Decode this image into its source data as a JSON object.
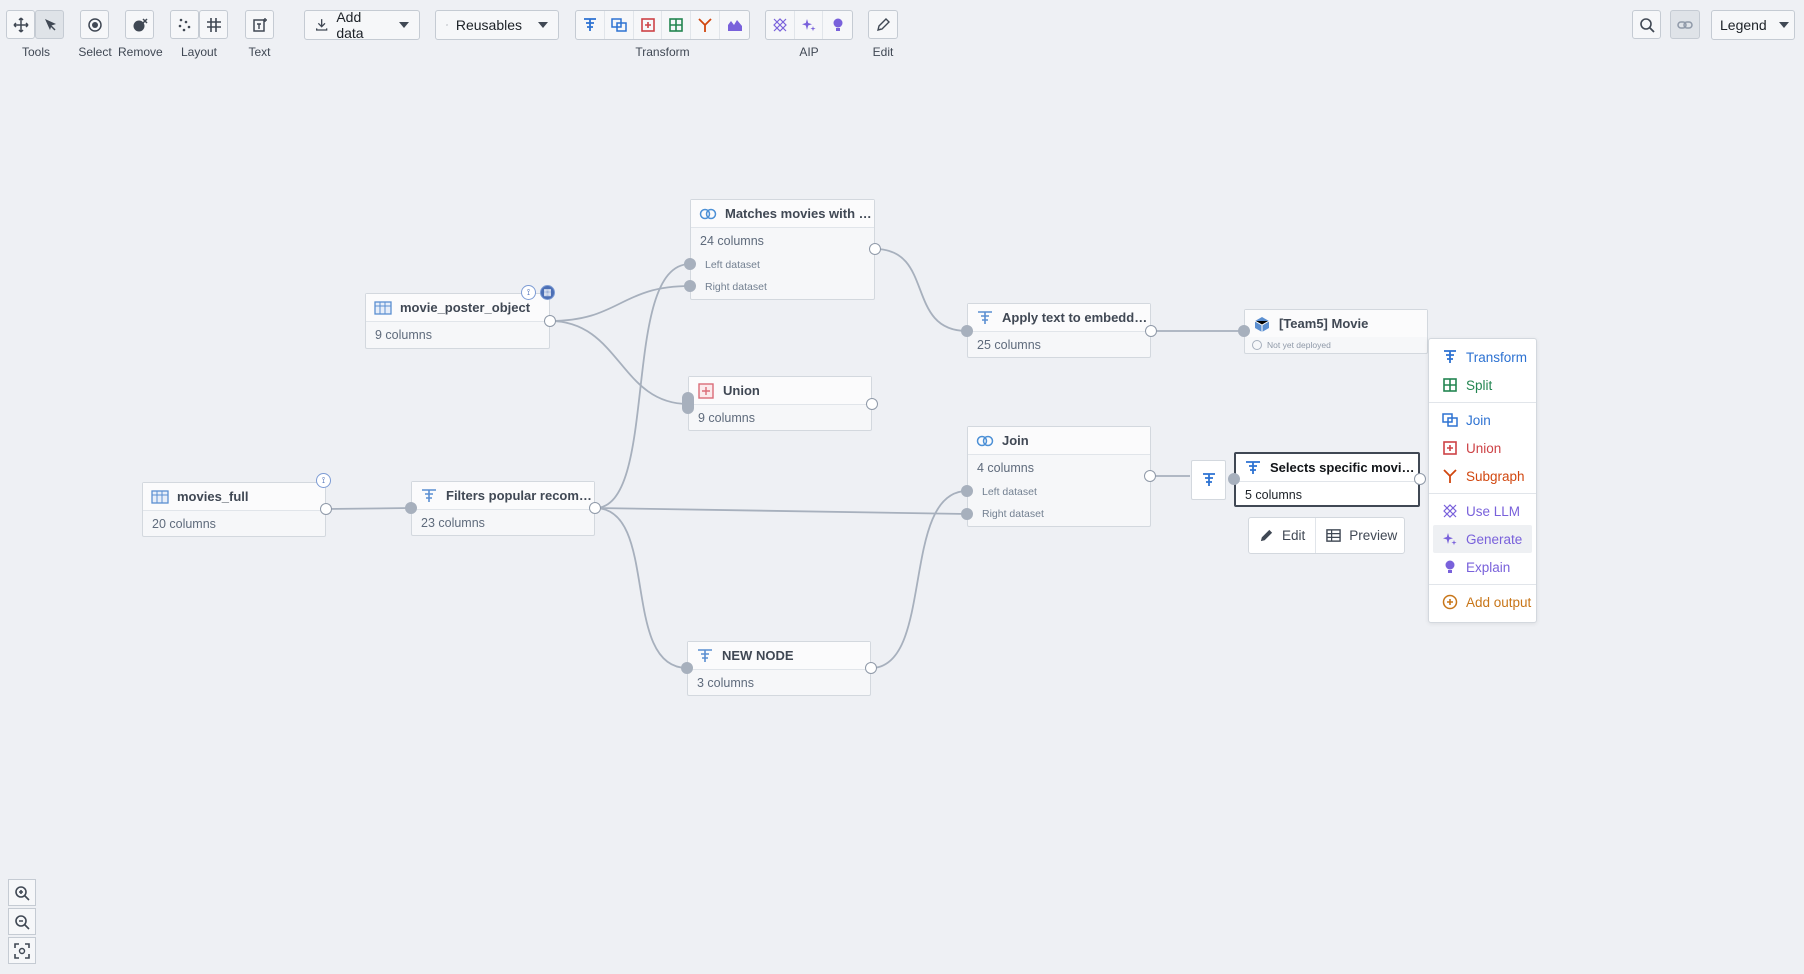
{
  "toolbar": {
    "tools_label": "Tools",
    "select_label": "Select",
    "remove_label": "Remove",
    "layout_label": "Layout",
    "text_label": "Text",
    "add_data": "Add data",
    "reusables": "Reusables",
    "transform_label": "Transform",
    "aip_label": "AIP",
    "edit_label": "Edit",
    "legend": "Legend"
  },
  "nodes": {
    "matches": {
      "title": "Matches movies with pos...",
      "cols": "24 columns",
      "left": "Left dataset",
      "right": "Right dataset"
    },
    "poster": {
      "title": "movie_poster_object",
      "cols": "9 columns"
    },
    "union": {
      "title": "Union",
      "cols": "9 columns"
    },
    "embed": {
      "title": "Apply text to embedding...",
      "cols": "25 columns"
    },
    "team5": {
      "title": "[Team5] Movie",
      "status": "Not yet deployed"
    },
    "join": {
      "title": "Join",
      "cols": "4 columns",
      "left": "Left dataset",
      "right": "Right dataset"
    },
    "selects": {
      "title": "Selects specific movie id...",
      "cols": "5 columns"
    },
    "movies_full": {
      "title": "movies_full",
      "cols": "20 columns"
    },
    "filters": {
      "title": "Filters popular recomme...",
      "cols": "23 columns"
    },
    "new_node": {
      "title": "NEW NODE",
      "cols": "3 columns"
    }
  },
  "popover": {
    "edit": "Edit",
    "preview": "Preview"
  },
  "menu": {
    "transform": "Transform",
    "split": "Split",
    "join": "Join",
    "union": "Union",
    "subgraph": "Subgraph",
    "use_llm": "Use LLM",
    "generate": "Generate",
    "explain": "Explain",
    "add_output": "Add output"
  },
  "colors": {
    "transform": "#2d72d2",
    "split": "#238551",
    "join": "#2d72d2",
    "union": "#cd4246",
    "subgraph": "#d1470f",
    "llm": "#7961db",
    "add_output": "#c87619"
  }
}
